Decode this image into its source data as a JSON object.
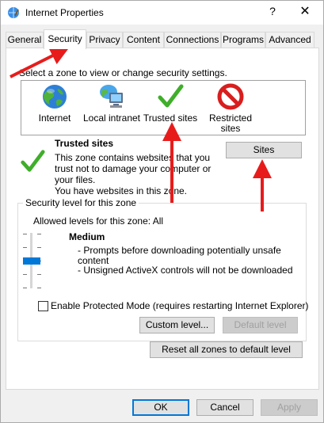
{
  "window": {
    "title": "Internet Properties",
    "help_glyph": "?",
    "close_glyph": "✕"
  },
  "tabs": [
    {
      "label": "General"
    },
    {
      "label": "Security",
      "active": true
    },
    {
      "label": "Privacy"
    },
    {
      "label": "Content"
    },
    {
      "label": "Connections"
    },
    {
      "label": "Programs"
    },
    {
      "label": "Advanced"
    }
  ],
  "security": {
    "instruction": "Select a zone to view or change security settings.",
    "zones": [
      {
        "label": "Internet",
        "icon": "globe-icon"
      },
      {
        "label": "Local intranet",
        "icon": "network-computer-icon"
      },
      {
        "label": "Trusted sites",
        "icon": "green-checkmark-icon"
      },
      {
        "label": "Restricted\nsites",
        "icon": "restricted-icon"
      }
    ],
    "selected_zone": {
      "title": "Trusted sites",
      "desc_lines": [
        "This zone contains websites that you",
        "trust not to damage your computer or",
        "your files.",
        "You have websites in this zone."
      ]
    },
    "sites_button": "Sites",
    "level_group_title": "Security level for this zone",
    "allowed_levels": "Allowed levels for this zone: All",
    "level_name": "Medium",
    "level_desc_lines": [
      "- Prompts before downloading potentially unsafe",
      "  content",
      "- Unsigned ActiveX controls will not be downloaded"
    ],
    "protected_mode_label": "Enable Protected Mode (requires restarting Internet Explorer)",
    "protected_mode_checked": false,
    "custom_level_button": "Custom level...",
    "default_level_button": "Default level",
    "reset_all_button": "Reset all zones to default level"
  },
  "footer": {
    "ok": "OK",
    "cancel": "Cancel",
    "apply": "Apply"
  },
  "colors": {
    "annotation_arrow": "#e81b1b",
    "slider_thumb": "#0078d7",
    "check_green": "#3fae2a"
  }
}
